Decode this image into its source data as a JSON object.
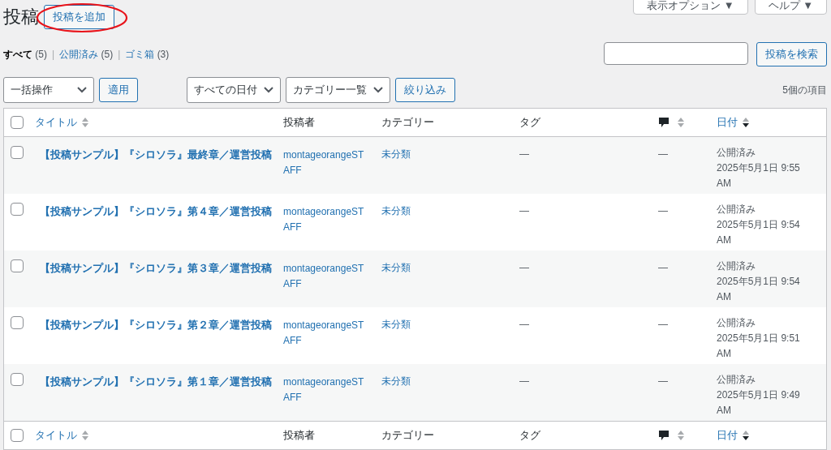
{
  "screen_options": [
    {
      "label": "表示オプション ▼"
    },
    {
      "label": "ヘルプ ▼"
    }
  ],
  "heading": {
    "title": "投稿",
    "add_button": "投稿を追加",
    "circled": true
  },
  "views": [
    {
      "label": "すべて",
      "count": "(5)",
      "selected": true
    },
    {
      "separator": "|",
      "label": "公開済み",
      "count": "(5)",
      "selected": false
    },
    {
      "separator": "|",
      "label": "ゴミ箱",
      "count": "(3)",
      "selected": false
    }
  ],
  "search": {
    "button": "投稿を検索"
  },
  "tablenav": {
    "bulk_action": "一括操作",
    "apply": "適用",
    "date_filter": "すべての日付",
    "category_filter": "カテゴリー一覧",
    "filter_button": "絞り込み",
    "count": "5個の項目"
  },
  "table": {
    "header_checked": false,
    "footer_checked": false,
    "columns": [
      {
        "kind": "title",
        "label": "タイトル",
        "sorted_desc": false
      },
      {
        "kind": "text",
        "label": "投稿者"
      },
      {
        "kind": "text",
        "label": "カテゴリー"
      },
      {
        "kind": "text",
        "label": "タグ"
      },
      {
        "kind": "comments",
        "sorted_desc": false
      },
      {
        "kind": "date",
        "label": "日付",
        "sorted_desc": true
      }
    ],
    "footer_columns": [
      {
        "kind": "title",
        "label": "タイトル",
        "sorted_desc": false
      },
      {
        "kind": "text",
        "label": "投稿者"
      },
      {
        "kind": "text",
        "label": "カテゴリー"
      },
      {
        "kind": "text",
        "label": "タグ"
      },
      {
        "kind": "comments",
        "sorted_desc": false
      },
      {
        "kind": "date",
        "label": "日付",
        "sorted_desc": true
      }
    ],
    "rows": [
      {
        "checked": false,
        "title": "【投稿サンプル】『シロソラ』最終章／運営投稿",
        "author": "montageorangeSTAFF",
        "category": "未分類",
        "tags": "—",
        "comments": "—",
        "status": "公開済み",
        "date": "2025年5月1日 9:55 AM"
      },
      {
        "checked": false,
        "title": "【投稿サンプル】『シロソラ』第４章／運営投稿",
        "author": "montageorangeSTAFF",
        "category": "未分類",
        "tags": "—",
        "comments": "—",
        "status": "公開済み",
        "date": "2025年5月1日 9:54 AM"
      },
      {
        "checked": false,
        "title": "【投稿サンプル】『シロソラ』第３章／運営投稿",
        "author": "montageorangeSTAFF",
        "category": "未分類",
        "tags": "—",
        "comments": "—",
        "status": "公開済み",
        "date": "2025年5月1日 9:54 AM"
      },
      {
        "checked": false,
        "title": "【投稿サンプル】『シロソラ』第２章／運営投稿",
        "author": "montageorangeSTAFF",
        "category": "未分類",
        "tags": "—",
        "comments": "—",
        "status": "公開済み",
        "date": "2025年5月1日 9:51 AM"
      },
      {
        "checked": false,
        "title": "【投稿サンプル】『シロソラ』第１章／運営投稿",
        "author": "montageorangeSTAFF",
        "category": "未分類",
        "tags": "—",
        "comments": "—",
        "status": "公開済み",
        "date": "2025年5月1日 9:49 AM"
      }
    ]
  }
}
